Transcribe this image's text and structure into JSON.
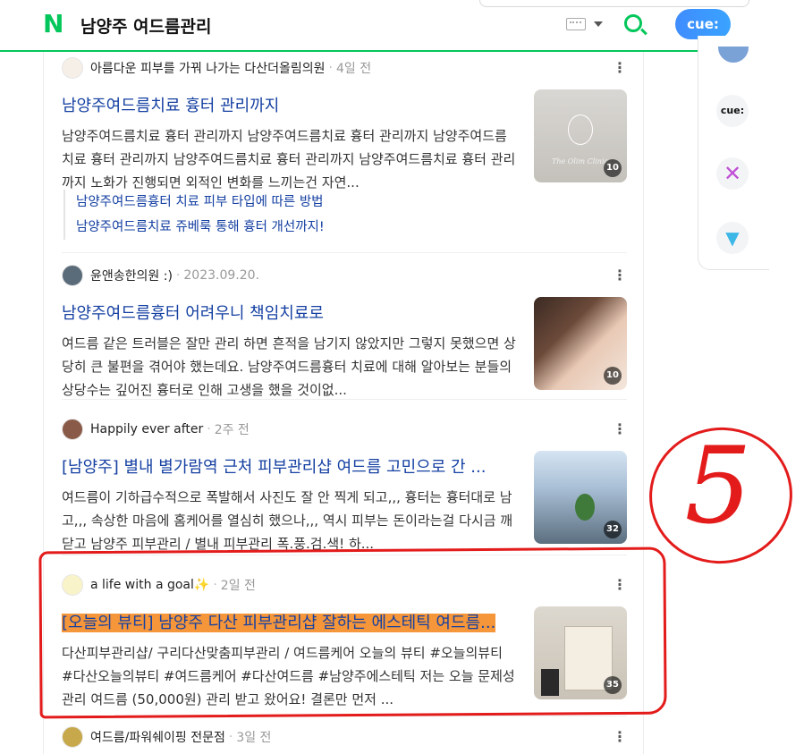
{
  "header": {
    "query": "남양주 여드름관리",
    "logo_letter": "N",
    "cue_label": "cue:"
  },
  "rail": {
    "cue_label": "cue:"
  },
  "results": [
    {
      "source": "아름다운 피부를 가꿔 나가는 다산더올림의원",
      "date": "4일 전",
      "title": "남양주여드름치료 흉터 관리까지",
      "desc": "남양주여드름치료 흉터 관리까지 남양주여드름치료 흉터 관리까지 남양주여드름치료 흉터 관리까지 남양주여드름치료 흉터 관리까지 남양주여드름치료 흉터 관리까지 노화가 진행되면 외적인 변화를 느끼는건 자연...",
      "subs": [
        "남양주여드름흉터 치료 피부 타입에 따른 방법",
        "남양주여드름치료 쥬베룩 통해 흉터 개선까지!"
      ],
      "count": "10",
      "thumb_caption": "The Olim Clinic"
    },
    {
      "source": "윤앤송한의원 :)",
      "date": "2023.09.20.",
      "title": "남양주여드름흉터 어려우니 책임치료로",
      "desc": "여드름 같은 트러블은 잘만 관리 하면 흔적을 남기지 않았지만 그렇지 못했으면 상당히 큰 불편을 겪어야 했는데요. 남양주여드름흉터 치료에 대해 알아보는 분들의 상당수는 깊어진 흉터로 인해 고생을 했을 것이없...",
      "count": "10"
    },
    {
      "source": "Happily ever after",
      "date": "2주 전",
      "title": "[남양주] 별내 별가람역 근처 피부관리샵 여드름 고민으로 간 ...",
      "desc": "여드름이 기하급수적으로 폭발해서 사진도 잘 안 찍게 되고,,, 흉터는 흉터대로 남고,,, 속상한 마음에 홈케어를 열심히 했으나,,, 역시 피부는 돈이라는걸 다시금 깨닫고 남양주 피부관리 / 별내 피부관리 폭.풍.검.색! 하...",
      "count": "32"
    },
    {
      "source": "a life with a goal✨",
      "date": "2일 전",
      "title": "[오늘의 뷰티] 남양주 다산 피부관리샵 잘하는 에스테틱 여드름...",
      "desc": "다산피부관리샵/ 구리다산맞춤피부관리 / 여드름케어 오늘의 뷰티 #오늘의뷰티 #다산오늘의뷰티 #여드름케어 #다산여드름 #남양주에스테틱 저는 오늘 문제성관리 여드름 (50,000원) 관리 받고 왔어요! 결론만 먼저 ...",
      "count": "35"
    },
    {
      "source": "여드름/파워쉐이핑 전문점",
      "date": "3일 전"
    }
  ],
  "annotation": {
    "number": "5",
    "color": "#e31b1b"
  },
  "colors": {
    "brand": "#03c75a",
    "title_link": "#1540a2",
    "highlight": "#f5963a"
  }
}
